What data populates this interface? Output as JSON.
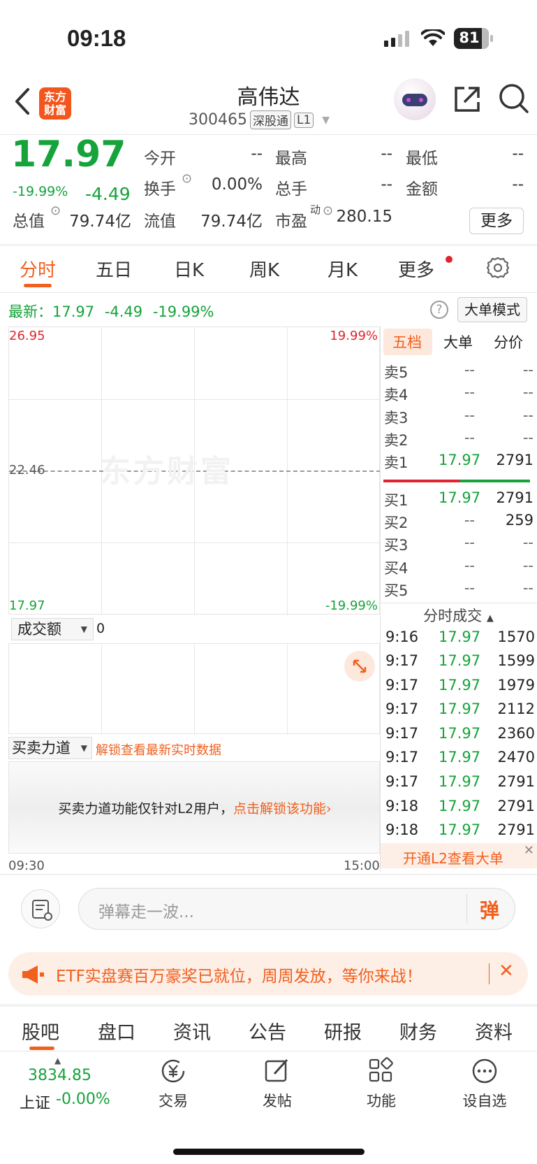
{
  "status_bar": {
    "time": "09:18",
    "battery": "81"
  },
  "header": {
    "back_icon": "chevron-left-icon",
    "logo_text": "东方财富",
    "title": "高伟达",
    "code": "300465",
    "tag1": "深股通",
    "tag2": "L1"
  },
  "quote": {
    "price": "17.97",
    "change_pct": "-19.99%",
    "change": "-4.49",
    "open_label": "今开",
    "open_value": "--",
    "high_label": "最高",
    "high_value": "--",
    "low_label": "最低",
    "low_value": "--",
    "turnover_label": "换手",
    "turnover_value": "0.00%",
    "volume_label": "总手",
    "volume_value": "--",
    "amount_label": "金额",
    "amount_value": "--",
    "mktcap_label": "总值",
    "mktcap_value": "79.74亿",
    "float_label": "流值",
    "float_value": "79.74亿",
    "pe_label": "市盈",
    "pe_sup": "动",
    "pe_value": "280.15",
    "more_button": "更多"
  },
  "tabs": [
    "分时",
    "五日",
    "日K",
    "周K",
    "月K",
    "更多"
  ],
  "chart": {
    "latest_label": "最新：",
    "latest_price": "17.97",
    "latest_change": "-4.49",
    "latest_pct": "-19.99%",
    "mode_button": "大单模式",
    "y_top": "26.95",
    "y_mid": "22.46",
    "y_bottom": "17.97",
    "pct_top": "19.99%",
    "pct_bottom": "-19.99%",
    "watermark": "东方财富",
    "volume_select": "成交额",
    "volume_value": "0",
    "force_select": "买卖力道",
    "force_hint": "解锁查看最新实时数据",
    "locked_text": "买卖力道功能仅针对L2用户，",
    "locked_link": "点击解锁该功能",
    "time_start": "09:30",
    "time_end": "15:00"
  },
  "orderbook": {
    "tabs": [
      "五档",
      "大单",
      "分价"
    ],
    "asks": [
      {
        "label": "卖5",
        "price": "--",
        "vol": "--"
      },
      {
        "label": "卖4",
        "price": "--",
        "vol": "--"
      },
      {
        "label": "卖3",
        "price": "--",
        "vol": "--"
      },
      {
        "label": "卖2",
        "price": "--",
        "vol": "--"
      },
      {
        "label": "卖1",
        "price": "17.97",
        "vol": "2791"
      }
    ],
    "bids": [
      {
        "label": "买1",
        "price": "17.97",
        "vol": "2791"
      },
      {
        "label": "买2",
        "price": "--",
        "vol": "259"
      },
      {
        "label": "买3",
        "price": "--",
        "vol": "--"
      },
      {
        "label": "买4",
        "price": "--",
        "vol": "--"
      },
      {
        "label": "买5",
        "price": "--",
        "vol": "--"
      }
    ],
    "ticks_title": "分时成交",
    "ticks": [
      {
        "time": "9:16",
        "price": "17.97",
        "vol": "1570"
      },
      {
        "time": "9:17",
        "price": "17.97",
        "vol": "1599"
      },
      {
        "time": "9:17",
        "price": "17.97",
        "vol": "1979"
      },
      {
        "time": "9:17",
        "price": "17.97",
        "vol": "2112"
      },
      {
        "time": "9:17",
        "price": "17.97",
        "vol": "2360"
      },
      {
        "time": "9:17",
        "price": "17.97",
        "vol": "2470"
      },
      {
        "time": "9:17",
        "price": "17.97",
        "vol": "2791"
      },
      {
        "time": "9:18",
        "price": "17.97",
        "vol": "2791"
      },
      {
        "time": "9:18",
        "price": "17.97",
        "vol": "2791"
      }
    ],
    "l2_banner": "开通L2查看大单"
  },
  "danmaku": {
    "placeholder": "弹幕走一波...",
    "send_icon_text": "弹"
  },
  "promo": {
    "text": "ETF实盘赛百万豪奖已就位，周周发放，等你来战！"
  },
  "bottom_tabs": [
    "股吧",
    "盘口",
    "资讯",
    "公告",
    "研报",
    "财务",
    "资料"
  ],
  "bottom_nav": {
    "index_value": "3834.85",
    "index_name": "上证",
    "index_change": "-0.00%",
    "items": [
      "交易",
      "发帖",
      "功能",
      "设自选"
    ]
  },
  "colors": {
    "accent": "#f0601e",
    "down": "#15a33a",
    "up": "#e0242d"
  }
}
